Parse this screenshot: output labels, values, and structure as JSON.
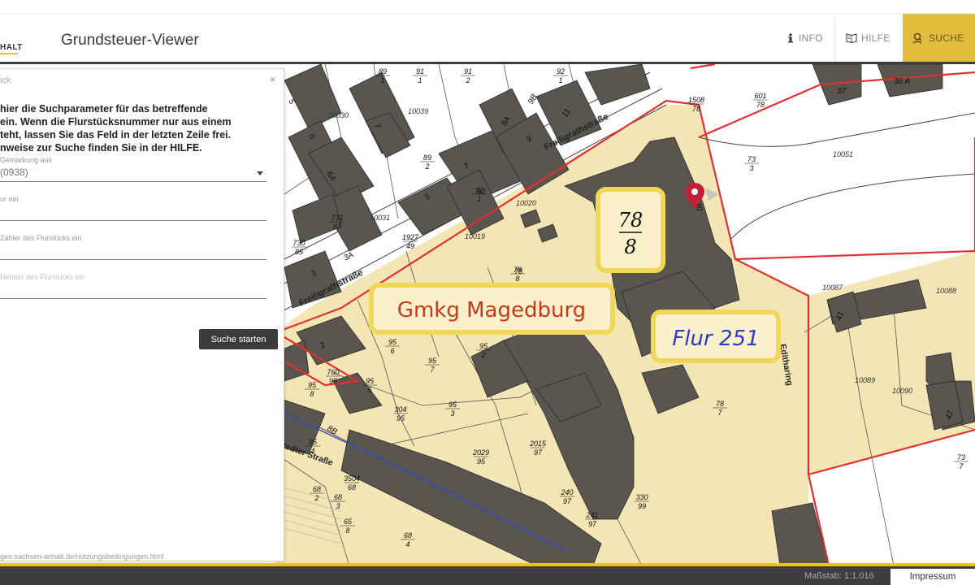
{
  "header": {
    "logo_text": "HALT",
    "title": "Grundsteuer-Viewer",
    "nav": [
      {
        "label": "INFO",
        "icon": "info-icon"
      },
      {
        "label": "HILFE",
        "icon": "help-book-icon"
      },
      {
        "label": "SUCHE",
        "icon": "user-search-icon"
      }
    ]
  },
  "search_panel": {
    "title": "ick",
    "close": "×",
    "intro_lines": [
      "hier die Suchparameter für das betreffende",
      "ein. Wenn die Flurstücksnummer nur aus einem",
      "teht, lassen Sie das Feld in der letzten Zeile frei.",
      "nweise zur Suche finden Sie in der HILFE."
    ],
    "fields": [
      {
        "label": "Gemarkung aus",
        "value": "(0938)",
        "type": "select"
      },
      {
        "label": "ur ein",
        "value": "",
        "type": "text"
      },
      {
        "label": "Zähler des Flurstücks ein",
        "value": "",
        "type": "text"
      },
      {
        "label": "Nenner des Flurstücks ein",
        "value": "",
        "type": "text"
      }
    ],
    "submit_label": "Suche starten",
    "link_fragment": "geo.sachsen-anhalt.de/nutzungsbedingungen.html"
  },
  "map": {
    "streets": [
      "Freiligrathstraße",
      "Freiligrathstraße",
      "Editharing",
      "stedter Straße"
    ],
    "house_numbers": [
      "5",
      "6",
      "6A",
      "7",
      "9",
      "9A",
      "9B",
      "11",
      "5",
      "7",
      "3",
      "3A",
      "2",
      "8B",
      "40",
      "41",
      "42",
      "37",
      "36 A"
    ],
    "parcel_ids": [
      "10030",
      "10039",
      "10031",
      "10019",
      "10020",
      "10051",
      "10087",
      "10088",
      "10089",
      "10090"
    ],
    "fractions": [
      {
        "n": "89",
        "d": "1"
      },
      {
        "n": "91",
        "d": "1"
      },
      {
        "n": "91",
        "d": "2"
      },
      {
        "n": "92",
        "d": "1"
      },
      {
        "n": "89",
        "d": "2"
      },
      {
        "n": "92",
        "d": "1"
      },
      {
        "n": "1508",
        "d": "78"
      },
      {
        "n": "601",
        "d": "78"
      },
      {
        "n": "73",
        "d": "3"
      },
      {
        "n": "731",
        "d": "87"
      },
      {
        "n": "730",
        "d": "85"
      },
      {
        "n": "1927",
        "d": "49"
      },
      {
        "n": "78",
        "d": "8"
      },
      {
        "n": "78",
        "d": "7"
      },
      {
        "n": "95",
        "d": "6"
      },
      {
        "n": "95",
        "d": "7"
      },
      {
        "n": "95",
        "d": "2"
      },
      {
        "n": "95",
        "d": "5"
      },
      {
        "n": "760",
        "d": "95"
      },
      {
        "n": "95",
        "d": "8"
      },
      {
        "n": "95",
        "d": "3"
      },
      {
        "n": "304",
        "d": "95"
      },
      {
        "n": "95",
        "d": "4"
      },
      {
        "n": "2029",
        "d": "95"
      },
      {
        "n": "2015",
        "d": "97"
      },
      {
        "n": "3504",
        "d": "68"
      },
      {
        "n": "68",
        "d": "2"
      },
      {
        "n": "68",
        "d": "3"
      },
      {
        "n": "65",
        "d": "8"
      },
      {
        "n": "68",
        "d": "4"
      },
      {
        "n": "240",
        "d": "97"
      },
      {
        "n": "241",
        "d": "97"
      },
      {
        "n": "330",
        "d": "99"
      },
      {
        "n": "73",
        "d": "7"
      },
      {
        "n": "78",
        "d": ""
      },
      {
        "n": "92",
        "d": ""
      }
    ],
    "callouts": {
      "gemarkung": "Gmkg Magedburg",
      "flur": "Flur 251",
      "flurstueck": {
        "n": "78",
        "d": "8"
      }
    },
    "colors": {
      "highlight": "#f4e5b5",
      "boundary": "#e03030",
      "building": "#595650",
      "callout_border": "#f0d75a",
      "marker": "#c41e3a"
    }
  },
  "footer": {
    "scale": "Maßstab: 1:1.016",
    "impressum": "Impressum"
  }
}
